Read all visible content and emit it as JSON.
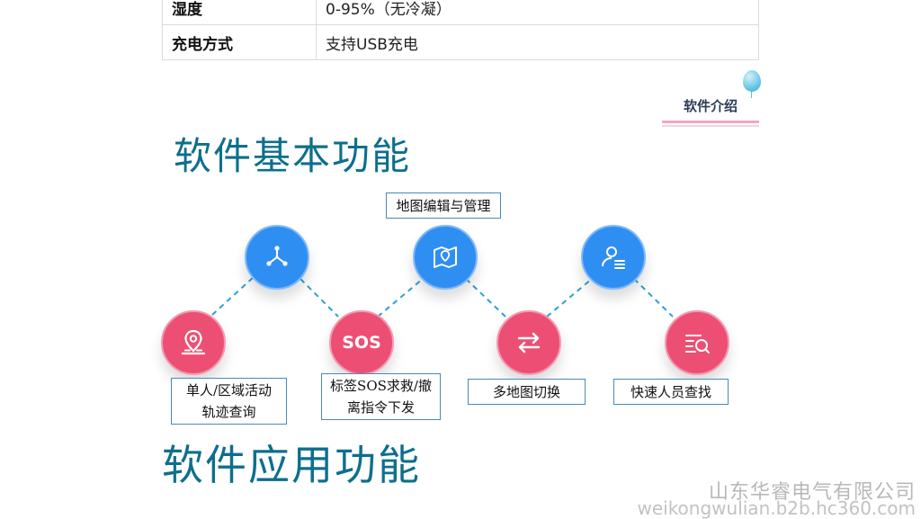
{
  "spec_table": {
    "rows": [
      {
        "key": "湿度",
        "value": "0-95%（无冷凝）"
      },
      {
        "key": "充电方式",
        "value": "支持USB充电"
      }
    ]
  },
  "section_tag": "软件介绍",
  "headings": {
    "basic": "软件基本功能",
    "application": "软件应用功能"
  },
  "diagram": {
    "nodes": [
      {
        "icon": "map-pin-icon",
        "color": "#ec4f73",
        "label_lines": [
          "单人/区域活动",
          "轨迹查询"
        ]
      },
      {
        "icon": "network-nodes-icon",
        "color": "#2f8ef2"
      },
      {
        "icon": "sos-icon",
        "text": "SOS",
        "color": "#ec4f73",
        "label_lines": [
          "标签SOS求救/撤",
          "离指令下发"
        ]
      },
      {
        "icon": "map-icon",
        "color": "#2f8ef2",
        "label_lines": [
          "地图编辑与管理"
        ]
      },
      {
        "icon": "switch-arrows-icon",
        "color": "#ec4f73",
        "label_lines": [
          "多地图切换"
        ]
      },
      {
        "icon": "user-list-icon",
        "color": "#2f8ef2"
      },
      {
        "icon": "search-list-icon",
        "color": "#ec4f73",
        "label_lines": [
          "快速人员查找"
        ]
      }
    ],
    "link_color": "#2f9fd6"
  },
  "watermark": {
    "company": "山东华睿电气有限公司",
    "url": "weikongwulian.b2b.hc360.com"
  }
}
